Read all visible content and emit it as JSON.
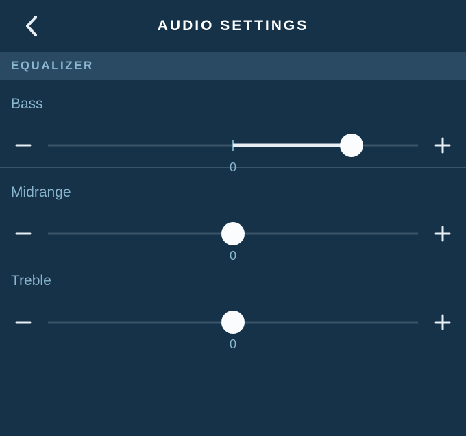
{
  "header": {
    "title": "AUDIO SETTINGS"
  },
  "section": {
    "equalizer_label": "EQUALIZER"
  },
  "sliders": {
    "bass": {
      "label": "Bass",
      "zero_label": "0",
      "pos_pct": 82,
      "fill_from_center_to_pct": 82,
      "show_tick": true
    },
    "mid": {
      "label": "Midrange",
      "zero_label": "0",
      "pos_pct": 50,
      "fill_from_center_to_pct": 50,
      "show_tick": false
    },
    "treble": {
      "label": "Treble",
      "zero_label": "0",
      "pos_pct": 50,
      "fill_from_center_to_pct": 50,
      "show_tick": false
    }
  }
}
